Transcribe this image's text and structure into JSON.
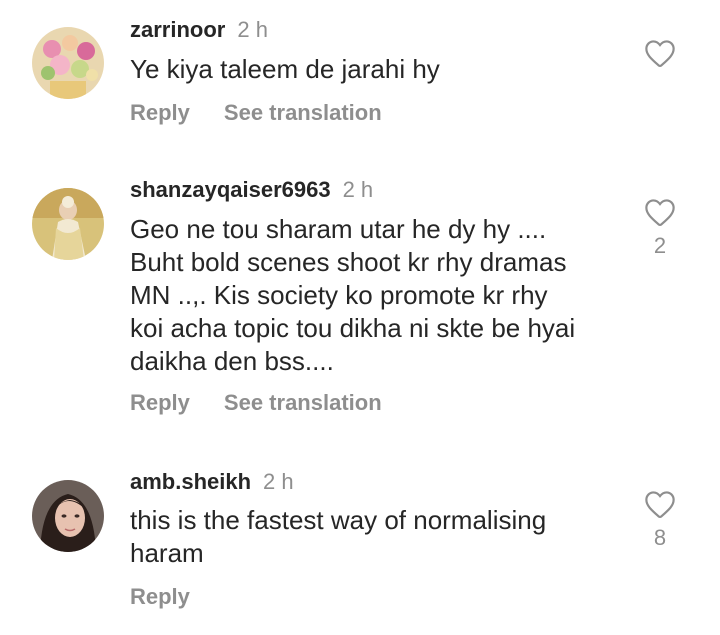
{
  "comments": [
    {
      "username": "zarrinoor",
      "time": "2 h",
      "text_lines": [
        "Ye kiya taleem de jarahi hy"
      ],
      "reply_label": "Reply",
      "translate_label": "See translation",
      "likes": ""
    },
    {
      "username": "shanzayqaiser6963",
      "time": "2 h",
      "text_lines": [
        "Geo ne tou sharam utar he dy hy ....",
        "Buht bold scenes shoot kr rhy dramas",
        "MN ..,. Kis society ko promote kr rhy",
        "koi acha topic tou dikha ni skte be hyai",
        "daikha den bss...."
      ],
      "reply_label": "Reply",
      "translate_label": "See translation",
      "likes": "2"
    },
    {
      "username": "amb.sheikh",
      "time": "2 h",
      "text_lines": [
        "this is the fastest way of normalising",
        "haram"
      ],
      "reply_label": "Reply",
      "likes": "8"
    }
  ],
  "colors": {
    "text": "#262626",
    "secondary": "#8e8e8e"
  }
}
